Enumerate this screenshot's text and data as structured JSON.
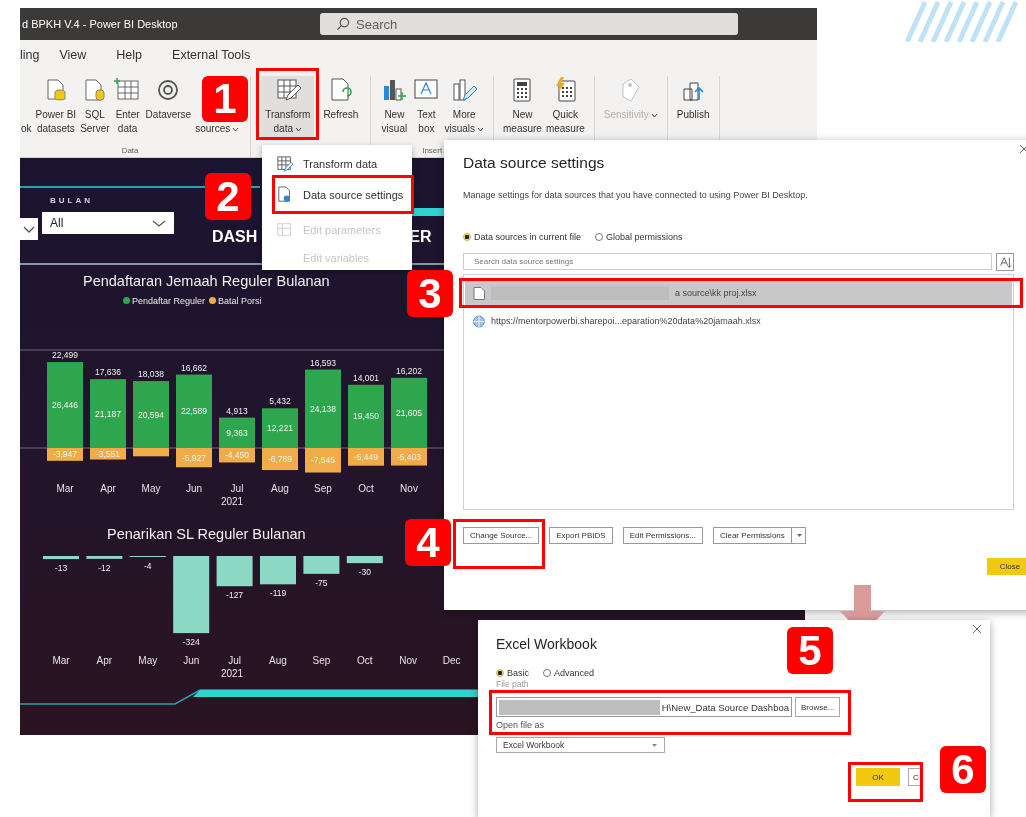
{
  "app_window": {
    "title": "d BPKH V.4 - Power BI Desktop",
    "search": {
      "placeholder": "Search"
    }
  },
  "menu": [
    {
      "label": "ling"
    },
    {
      "label": "View"
    },
    {
      "label": "Help"
    },
    {
      "label": "External Tools"
    }
  ],
  "ribbon": {
    "groups": [
      {
        "label": "Data",
        "items": [
          {
            "label": "ok",
            "caret": false,
            "disabled": false,
            "expanded": false
          },
          {
            "label": "Power BI\ndatasets",
            "caret": false,
            "disabled": false,
            "expanded": false
          },
          {
            "label": "SQL\nServer",
            "caret": false,
            "disabled": false,
            "expanded": false
          },
          {
            "label": "Enter\ndata",
            "caret": false,
            "disabled": false,
            "expanded": false
          },
          {
            "label": "Dataverse",
            "caret": false,
            "disabled": false,
            "expanded": false
          },
          {
            "label": "sources",
            "caret": true,
            "disabled": false,
            "expanded": false
          }
        ]
      },
      {
        "items": [
          {
            "label": "Transform\ndata",
            "caret": true,
            "disabled": false,
            "expanded": true
          },
          {
            "label": "Refresh",
            "caret": false,
            "disabled": false,
            "expanded": false
          }
        ]
      },
      {
        "label": "Insert",
        "items": [
          {
            "label": "New\nvisual",
            "caret": false,
            "disabled": false,
            "expanded": false
          },
          {
            "label": "Text\nbox",
            "caret": false,
            "disabled": false,
            "expanded": false
          },
          {
            "label": "More\nvisuals",
            "caret": true,
            "disabled": false,
            "expanded": false
          }
        ]
      },
      {
        "items": [
          {
            "label": "New\nmeasure",
            "caret": false,
            "disabled": false,
            "expanded": false
          },
          {
            "label": "Quick\nmeasure",
            "caret": false,
            "disabled": false,
            "expanded": false
          }
        ]
      },
      {
        "items": [
          {
            "label": "Sensitivity",
            "caret": true,
            "disabled": true,
            "expanded": false
          }
        ]
      },
      {
        "items": [
          {
            "label": "Publish",
            "caret": false,
            "disabled": false,
            "expanded": false
          }
        ]
      }
    ]
  },
  "transform_menu": [
    {
      "label": "Transform data",
      "disabled": false
    },
    {
      "label": "Data source settings",
      "disabled": false
    },
    {
      "label": "Edit parameters",
      "disabled": true
    },
    {
      "label": "Edit variables",
      "disabled": true
    }
  ],
  "dashboard": {
    "slicer": {
      "label": "BULAN",
      "value": "All"
    },
    "title_parts": [
      "DASH",
      "ER"
    ],
    "charts": [
      {
        "title": "Pendaftaran Jemaah Reguler Bulanan",
        "chart_data": {
          "type": "bar",
          "stacked": true,
          "xlabel": "2021",
          "categories": [
            "Mar",
            "Apr",
            "May",
            "Jun",
            "Jul",
            "Aug",
            "Sep",
            "Oct",
            "Nov"
          ],
          "totals": [
            "22,499",
            "17,636",
            "18,038",
            "16,662",
            "4,913",
            "5,432",
            "16,593",
            "14,001",
            "16,202"
          ],
          "series": [
            {
              "name": "Pendaftar Reguler",
              "color": "#2ea64e",
              "values": [
                26446,
                21187,
                20594,
                22589,
                9363,
                12221,
                24138,
                19450,
                21605
              ],
              "value_labels": [
                "26,446",
                "21,187",
                "20,594",
                "22,589",
                "9,363",
                "12,221",
                "24,138",
                "19,450",
                "21,605"
              ]
            },
            {
              "name": "Batal Porsi",
              "color": "#f0ac48",
              "values": [
                -3947,
                -3551,
                -2556,
                -5927,
                -4450,
                -6789,
                -7545,
                -5449,
                -5403
              ],
              "value_labels": [
                "-3,947",
                "-3,551",
                null,
                "-5,927",
                "-4,450",
                "-6,789",
                "-7,545",
                "-5,449",
                "-5,403"
              ]
            }
          ]
        }
      },
      {
        "title": "Penarikan SL Reguler Bulanan",
        "chart_data": {
          "type": "bar",
          "stacked": false,
          "xlabel": "2021",
          "categories": [
            "Mar",
            "Apr",
            "May",
            "Jun",
            "Jul",
            "Aug",
            "Sep",
            "Oct",
            "Nov",
            "Dec"
          ],
          "series": [
            {
              "color": "#8ed8c6",
              "values": [
                -13,
                -12,
                -4,
                -324,
                -127,
                -119,
                -75,
                -30,
                null,
                null
              ],
              "value_labels": [
                "-13",
                "-12",
                "-4",
                "-324",
                "-127",
                "-119",
                "-75",
                "-30",
                null,
                null
              ]
            }
          ]
        }
      }
    ]
  },
  "source_dialog": {
    "title": "Data source settings",
    "description": "Manage settings for data sources that you have connected to using Power BI Desktop.",
    "scope_options": [
      {
        "label": "Data sources in current file",
        "selected": true
      },
      {
        "label": "Global permissions",
        "selected": false
      }
    ],
    "search": {
      "placeholder": "Search data source settings"
    },
    "sources": [
      {
        "kind": "file",
        "path": "a source\\kk proj.xlsx",
        "redacted": true,
        "selected": true
      },
      {
        "kind": "web",
        "path": "https://mentorpowerbi.sharepoi...eparation%20data%20jamaah.xlsx",
        "redacted": false,
        "selected": false
      }
    ],
    "buttons": [
      {
        "label": "Change Source...",
        "split": false
      },
      {
        "label": "Export PBIDS",
        "split": false
      },
      {
        "label": "Edit Permissions...",
        "split": false
      },
      {
        "label": "Clear Permissions",
        "split": true
      }
    ],
    "close_button": "Close"
  },
  "excel_dialog": {
    "title": "Excel Workbook",
    "mode_options": [
      {
        "label": "Basic",
        "selected": true
      },
      {
        "label": "Advanced",
        "selected": false
      }
    ],
    "file_path": {
      "label": "File path",
      "value": "H\\New_Data Source Dashboa",
      "redacted": true
    },
    "browse_button": "Browse...",
    "open_as": {
      "label": "Open file as",
      "value": "Excel Workbook"
    },
    "ok_button": "OK",
    "cancel_button": "C"
  },
  "steps": [
    {
      "number": "1"
    },
    {
      "number": "2"
    },
    {
      "number": "3"
    },
    {
      "number": "4"
    },
    {
      "number": "5"
    },
    {
      "number": "6"
    }
  ]
}
